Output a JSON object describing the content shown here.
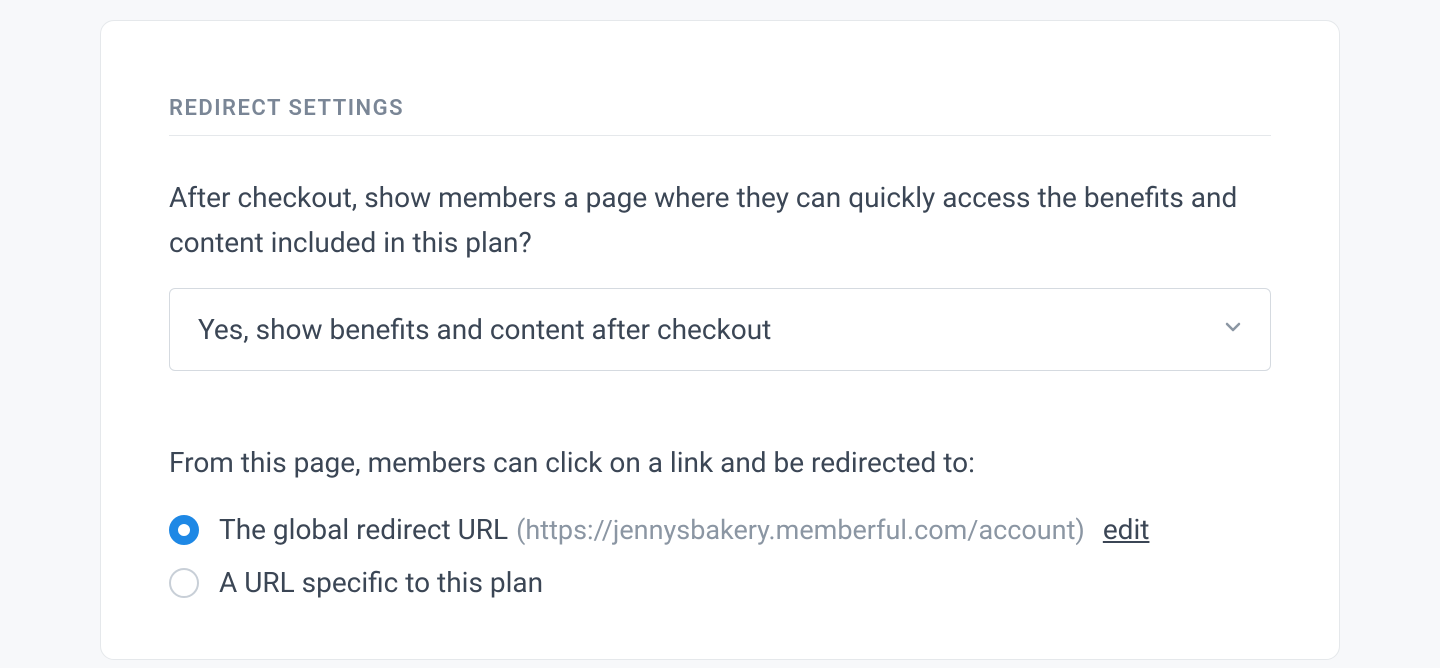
{
  "section": {
    "title": "REDIRECT SETTINGS",
    "description": "After checkout, show members a page where they can quickly access the benefits and content included in this plan?",
    "dropdown": {
      "selected": "Yes, show benefits and content after checkout"
    },
    "subDescription": "From this page, members can click on a link and be redirected to:",
    "radio": {
      "option1": {
        "label": "The global redirect URL",
        "url": "(https://jennysbakery.memberful.com/account)",
        "editLabel": "edit"
      },
      "option2": {
        "label": "A URL specific to this plan"
      }
    }
  }
}
